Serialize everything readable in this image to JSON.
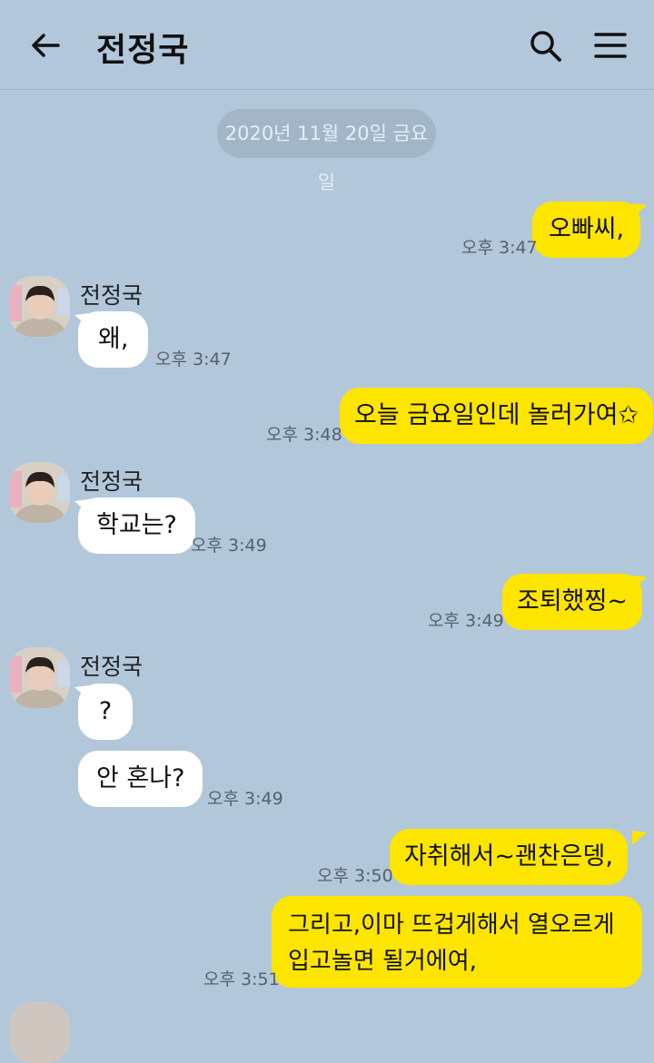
{
  "header": {
    "title": "전정국"
  },
  "date_divider": "2020년 11월 20일 금요일",
  "sender_name": "전정국",
  "messages": [
    {
      "text": "오빠씨,",
      "time": "오후 3:47"
    },
    {
      "text": "왜,",
      "time": "오후 3:47"
    },
    {
      "text": "오늘 금요일인데 놀러가여✩",
      "time": "오후 3:48"
    },
    {
      "text": "학교는?",
      "time": "오후 3:49"
    },
    {
      "text": "조퇴했찡~",
      "time": "오후 3:49"
    },
    {
      "text": "?",
      "time": ""
    },
    {
      "text": "안 혼나?",
      "time": "오후 3:49"
    },
    {
      "text": "자취해서~괜찬은뎅,",
      "time": "오후 3:50"
    },
    {
      "text": "그리고,이마 뜨겁게해서 열오르게 입고놀면 될거에여,",
      "time": "오후 3:51"
    }
  ],
  "colors": {
    "background": "#b2c7da",
    "my_bubble": "#fee500",
    "their_bubble": "#ffffff"
  },
  "icons": {
    "back": "arrow-left-icon",
    "search": "search-icon",
    "menu": "hamburger-menu-icon"
  }
}
